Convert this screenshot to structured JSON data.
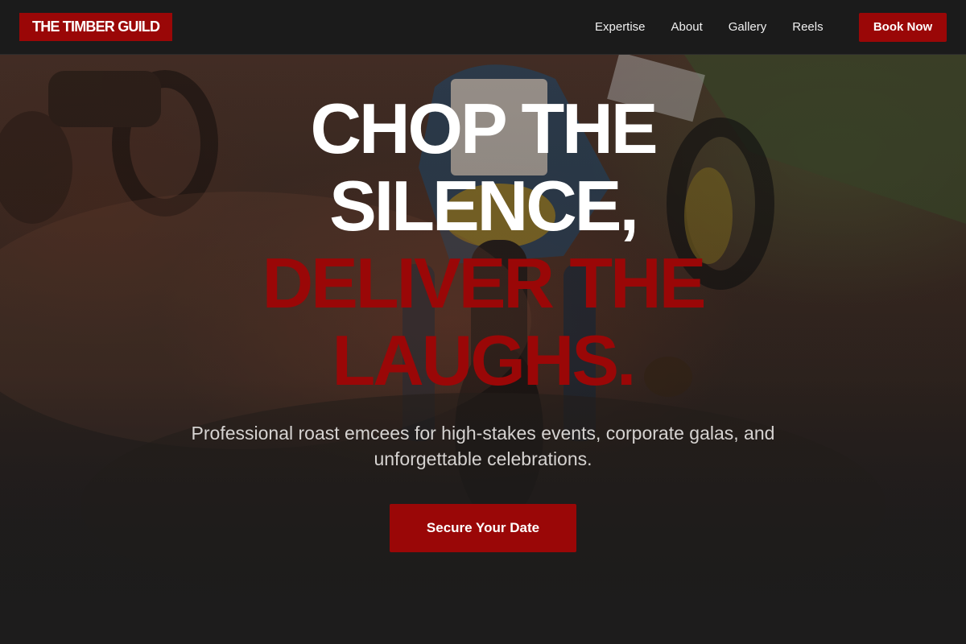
{
  "brand": {
    "name": "THE TIMBER GUILD"
  },
  "nav": {
    "links": [
      "Expertise",
      "About",
      "Gallery",
      "Reels"
    ],
    "cta_label": "Book Now"
  },
  "hero": {
    "headline": {
      "line1": "CHOP THE",
      "line2": "SILENCE,",
      "line3": "DELIVER THE",
      "line4": "LAUGHS."
    },
    "subtitle": "Professional roast emcees for high-stakes events, corporate galas, and unforgettable celebrations.",
    "cta_label": "Secure Your Date"
  },
  "colors": {
    "accent": "#9a0707",
    "nav_background": "#1b1b1b",
    "page_background": "#1c1c1c",
    "headline_white": "#ffffff",
    "subtitle_text": "#d6d3d1"
  },
  "icons": {
    "hero_background": "motorcycle-race-photo"
  }
}
